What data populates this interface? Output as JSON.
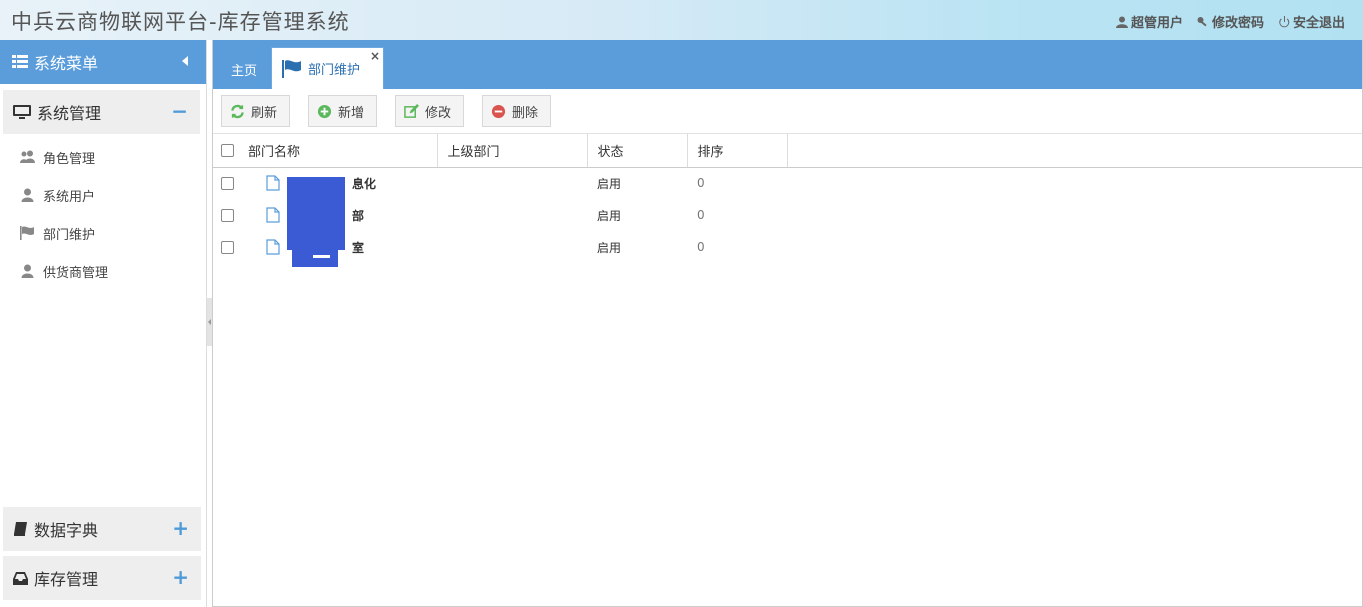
{
  "header": {
    "title": "中兵云商物联网平台-库存管理系统",
    "user_label": "超管用户",
    "change_password_label": "修改密码",
    "logout_label": "安全退出"
  },
  "sidebar": {
    "menu_title": "系统菜单",
    "groups": [
      {
        "label": "系统管理",
        "toggle": "−",
        "items": [
          {
            "label": "角色管理",
            "icon": "users-icon"
          },
          {
            "label": "系统用户",
            "icon": "user-icon"
          },
          {
            "label": "部门维护",
            "icon": "flag-icon"
          },
          {
            "label": "供货商管理",
            "icon": "user-icon"
          }
        ]
      },
      {
        "label": "数据字典",
        "toggle": "+"
      },
      {
        "label": "库存管理",
        "toggle": "+"
      }
    ]
  },
  "tabs": {
    "home_label": "主页",
    "active_label": "部门维护",
    "close": "×"
  },
  "toolbar": {
    "refresh_label": "刷新",
    "add_label": "新增",
    "edit_label": "修改",
    "delete_label": "删除"
  },
  "grid": {
    "columns": [
      "部门名称",
      "上级部门",
      "状态",
      "排序"
    ],
    "rows": [
      {
        "name": "息化",
        "parent": "",
        "status": "启用",
        "sort": "0"
      },
      {
        "name": "部",
        "parent": "",
        "status": "启用",
        "sort": "0"
      },
      {
        "name": "室",
        "parent": "",
        "status": "启用",
        "sort": "0"
      }
    ]
  },
  "colors": {
    "accent": "#5b9ddb",
    "redaction": "#3a5bd4"
  }
}
